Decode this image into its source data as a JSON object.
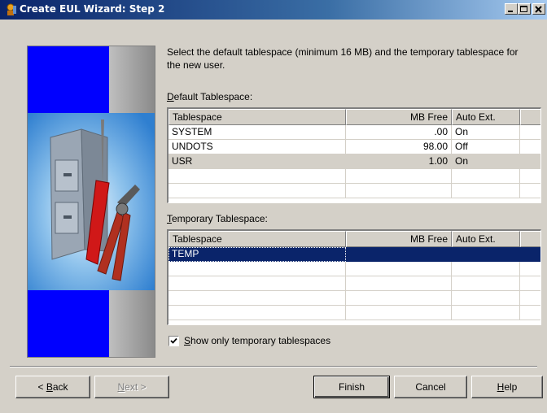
{
  "window": {
    "title": "Create EUL Wizard: Step 2",
    "controls": [
      "minimize-icon",
      "maximize-icon",
      "close-icon"
    ]
  },
  "intro_text": "Select the default tablespace (minimum 16 MB) and the temporary tablespace for the new user.",
  "default_group": {
    "label_hotkey": "D",
    "label_rest": "efault Tablespace:",
    "columns": [
      "Tablespace",
      "MB Free",
      "Auto Ext."
    ],
    "rows": [
      {
        "name": "SYSTEM",
        "mb_free": ".00",
        "auto_ext": "On"
      },
      {
        "name": "UNDOTS",
        "mb_free": "98.00",
        "auto_ext": "Off"
      },
      {
        "name": "USR",
        "mb_free": "1.00",
        "auto_ext": "On"
      }
    ]
  },
  "temp_group": {
    "label_hotkey": "T",
    "label_rest": "emporary Tablespace:",
    "columns": [
      "Tablespace",
      "MB Free",
      "Auto Ext."
    ],
    "rows": [
      {
        "name": "TEMP",
        "mb_free": "",
        "auto_ext": ""
      }
    ]
  },
  "show_temp_only": {
    "checked": true,
    "label_hotkey": "S",
    "label_rest": "how only temporary tablespaces"
  },
  "buttons": {
    "back": {
      "prefix": "< ",
      "hotkey": "B",
      "rest": "ack"
    },
    "next": {
      "hotkey": "N",
      "rest": "ext >"
    },
    "finish": "Finish",
    "cancel": "Cancel",
    "help": {
      "hotkey": "H",
      "rest": "elp"
    }
  },
  "side_image": "filing-cabinet-with-tools-illustration",
  "colors": {
    "title_gradient_start": "#0a246a",
    "selection": "#0a246a",
    "dialog_face": "#d4d0c8",
    "side_blue": "#0000ff"
  }
}
